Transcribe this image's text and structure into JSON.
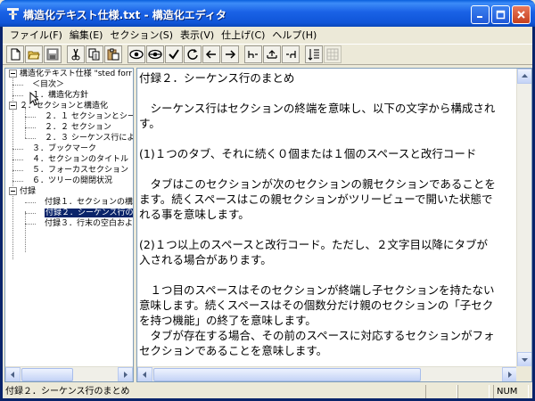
{
  "window": {
    "title": "構造化テキスト仕様.txt - 構造化エディタ"
  },
  "menu": {
    "items": [
      {
        "label": "ファイル(F)"
      },
      {
        "label": "編集(E)"
      },
      {
        "label": "セクション(S)"
      },
      {
        "label": "表示(V)"
      },
      {
        "label": "仕上げ(C)"
      },
      {
        "label": "ヘルプ(H)"
      }
    ]
  },
  "toolbar": {
    "buttons": [
      "new-icon",
      "open-icon",
      "save-icon",
      "cut-icon",
      "copy-icon",
      "paste-icon",
      "eye-icon",
      "eye-closed-icon",
      "check-icon",
      "refresh-icon",
      "arrow-left-icon",
      "arrow-right-icon",
      "indent-left-icon",
      "indent-up-icon",
      "indent-right-icon",
      "outline-icon",
      "grid-icon"
    ]
  },
  "tree": {
    "root": "構造化テキスト仕様 \"sted forr",
    "items": [
      {
        "label": "＜目次＞"
      },
      {
        "label": "１．構造化方針"
      },
      {
        "label": "２．セクションと構造化"
      },
      {
        "label": "２．１ セクションとシーケンス"
      },
      {
        "label": "２．２ セクション"
      },
      {
        "label": "２．３ シーケンス行による構"
      },
      {
        "label": "３．ブックマーク"
      },
      {
        "label": "４．セクションのタイトル"
      },
      {
        "label": "５．フォーカスセクション"
      },
      {
        "label": "６．ツリーの開閉状況"
      },
      {
        "label": "付録"
      },
      {
        "label": "付録１．セクションの構造化"
      },
      {
        "label": "付録２．シーケンス行のまと"
      },
      {
        "label": "付録３．行末の空白および"
      }
    ]
  },
  "document": {
    "lines": [
      "付録２．シーケンス行のまとめ",
      "",
      "　シーケンス行はセクションの終端を意味し、以下の文字から構成され",
      "す。",
      "",
      "(1)１つのタブ、それに続く０個または１個のスペースと改行コード",
      "",
      "　タブはこのセクションが次のセクションの親セクションであることを",
      "ます。続くスペースはこの親セクションがツリービューで開いた状態で",
      "れる事を意味します。",
      "",
      "(2)１つ以上のスペースと改行コード。ただし、２文字目以降にタブが",
      "入される場合があります。",
      "",
      "　１つ目のスペースはそのセクションが終端し子セクションを持たない",
      "意味します。続くスペースはその個数分だけ親のセクションの「子セク",
      "を持つ機能」の終了を意味します。",
      "　タブが存在する場合、その前のスペースに対応するセクションがフォ",
      "セクションであることを意味します。"
    ]
  },
  "status": {
    "text": "付録２．シーケンス行のまとめ",
    "num": "NUM"
  }
}
